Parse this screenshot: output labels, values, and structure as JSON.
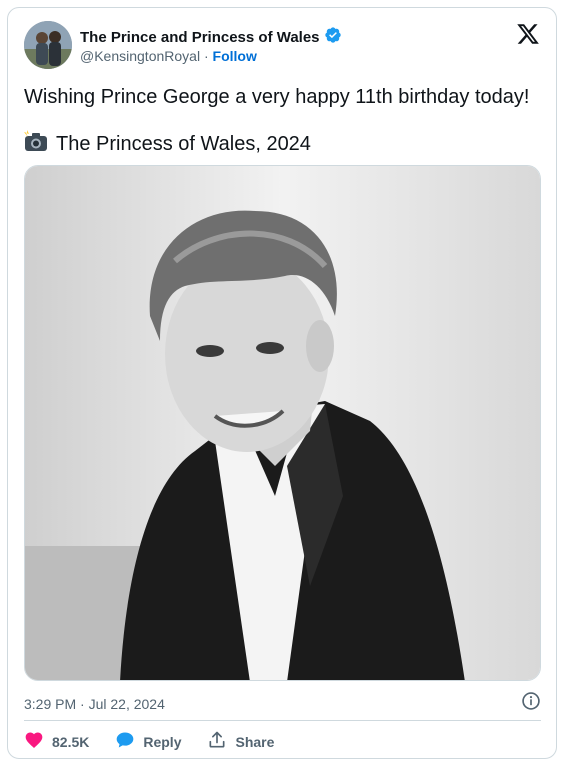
{
  "account": {
    "display_name": "The Prince and Princess of Wales",
    "handle": "@KensingtonRoyal",
    "separator": "·",
    "follow_label": "Follow"
  },
  "tweet": {
    "text_line1": "Wishing Prince George a very happy 11th birthday today!",
    "text_line2": "The Princess of Wales, 2024",
    "timestamp": "3:29 PM · Jul 22, 2024"
  },
  "actions": {
    "like_count": "82.5K",
    "reply_label": "Reply",
    "share_label": "Share"
  },
  "colors": {
    "verified": "#1d9bf0",
    "follow": "#006fd6",
    "like": "#f91880",
    "reply": "#1d9bf0"
  },
  "icons": [
    "verified-badge-icon",
    "x-logo-icon",
    "camera-flash-icon",
    "info-icon",
    "heart-icon",
    "reply-bubble-icon",
    "share-icon"
  ]
}
